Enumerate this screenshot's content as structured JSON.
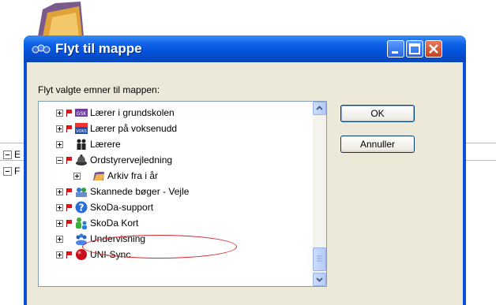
{
  "background": {
    "rows": [
      "E",
      "F"
    ]
  },
  "dialog": {
    "title": "Flyt til mappe",
    "prompt": "Flyt valgte emner til mappen:",
    "buttons": {
      "ok": "OK",
      "cancel": "Annuller"
    },
    "tree_items": [
      {
        "label": "Lærer i grundskolen",
        "expander": "plus",
        "flag": true,
        "icon": "gsk-icon"
      },
      {
        "label": "Lærer på voksenudd",
        "expander": "plus",
        "flag": true,
        "icon": "voks-icon"
      },
      {
        "label": "Lærere",
        "expander": "plus",
        "flag": false,
        "icon": "people-icon"
      },
      {
        "label": "Ordstyrervejledning",
        "expander": "minus",
        "flag": true,
        "icon": "bell-icon"
      },
      {
        "label": "Arkiv fra i år",
        "expander": "plus",
        "flag": false,
        "icon": "folder-icon",
        "indent": 1
      },
      {
        "label": "Skannede bøger - Vejle",
        "expander": "plus",
        "flag": true,
        "icon": "scanner-icon"
      },
      {
        "label": "SkoDa-support",
        "expander": "plus",
        "flag": true,
        "icon": "help-icon"
      },
      {
        "label": "SkoDa Kort",
        "expander": "plus",
        "flag": true,
        "icon": "people-green-icon"
      },
      {
        "label": "Undervisning",
        "expander": "plus",
        "flag": false,
        "icon": "group-icon"
      },
      {
        "label": "UNI-Sync",
        "expander": "plus",
        "flag": true,
        "icon": "red-ball-icon"
      }
    ]
  }
}
